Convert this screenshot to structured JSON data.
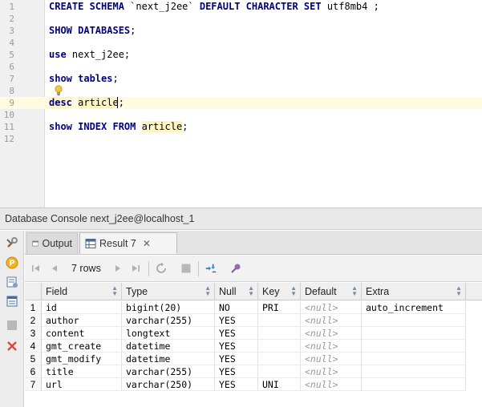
{
  "editor": {
    "lines": [
      {
        "n": "1",
        "tokens": [
          {
            "t": "CREATE SCHEMA ",
            "k": true
          },
          {
            "t": "`next_j2ee` ",
            "k": false
          },
          {
            "t": "DEFAULT CHARACTER SET ",
            "k": true
          },
          {
            "t": "utf8mb4 ;",
            "k": false
          }
        ]
      },
      {
        "n": "2",
        "tokens": []
      },
      {
        "n": "3",
        "tokens": [
          {
            "t": "SHOW DATABASES",
            "k": true
          },
          {
            "t": ";",
            "k": false
          }
        ]
      },
      {
        "n": "4",
        "tokens": []
      },
      {
        "n": "5",
        "tokens": [
          {
            "t": "use ",
            "k": true
          },
          {
            "t": "next_j2ee;",
            "k": false
          }
        ]
      },
      {
        "n": "6",
        "tokens": []
      },
      {
        "n": "7",
        "tokens": [
          {
            "t": "show tables",
            "k": true
          },
          {
            "t": ";",
            "k": false
          }
        ]
      },
      {
        "n": "8",
        "tokens": []
      },
      {
        "n": "9",
        "tokens": [
          {
            "t": "desc",
            "k": true,
            "h": true
          },
          {
            "t": " ",
            "k": false
          },
          {
            "t": "article",
            "k": false,
            "h": true
          },
          {
            "t": ";",
            "k": false
          }
        ],
        "current": true
      },
      {
        "n": "10",
        "tokens": []
      },
      {
        "n": "11",
        "tokens": [
          {
            "t": "show INDEX FROM ",
            "k": true
          },
          {
            "t": "article",
            "k": false,
            "h": true
          },
          {
            "t": ";",
            "k": false
          }
        ]
      },
      {
        "n": "12",
        "tokens": []
      }
    ]
  },
  "console": {
    "title": "Database Console next_j2ee@localhost_1"
  },
  "tabs": {
    "output": "Output",
    "result": "Result 7",
    "close": "✕"
  },
  "toolbar": {
    "rows": "7 rows"
  },
  "grid": {
    "columns": [
      "Field",
      "Type",
      "Null",
      "Key",
      "Default",
      "Extra"
    ],
    "rows": [
      {
        "n": "1",
        "cells": [
          "id",
          "bigint(20)",
          "NO",
          "PRI",
          "<null>",
          "auto_increment"
        ]
      },
      {
        "n": "2",
        "cells": [
          "author",
          "varchar(255)",
          "YES",
          "",
          "<null>",
          ""
        ]
      },
      {
        "n": "3",
        "cells": [
          "content",
          "longtext",
          "YES",
          "",
          "<null>",
          ""
        ]
      },
      {
        "n": "4",
        "cells": [
          "gmt_create",
          "datetime",
          "YES",
          "",
          "<null>",
          ""
        ]
      },
      {
        "n": "5",
        "cells": [
          "gmt_modify",
          "datetime",
          "YES",
          "",
          "<null>",
          ""
        ]
      },
      {
        "n": "6",
        "cells": [
          "title",
          "varchar(255)",
          "YES",
          "",
          "<null>",
          ""
        ]
      },
      {
        "n": "7",
        "cells": [
          "url",
          "varchar(250)",
          "YES",
          "UNI",
          "<null>",
          ""
        ]
      }
    ]
  },
  "colors": {
    "keyword": "#000080",
    "highlight": "#fdf5c3",
    "current_line": "#fffbe0",
    "null_text": "#9a9a9a"
  }
}
